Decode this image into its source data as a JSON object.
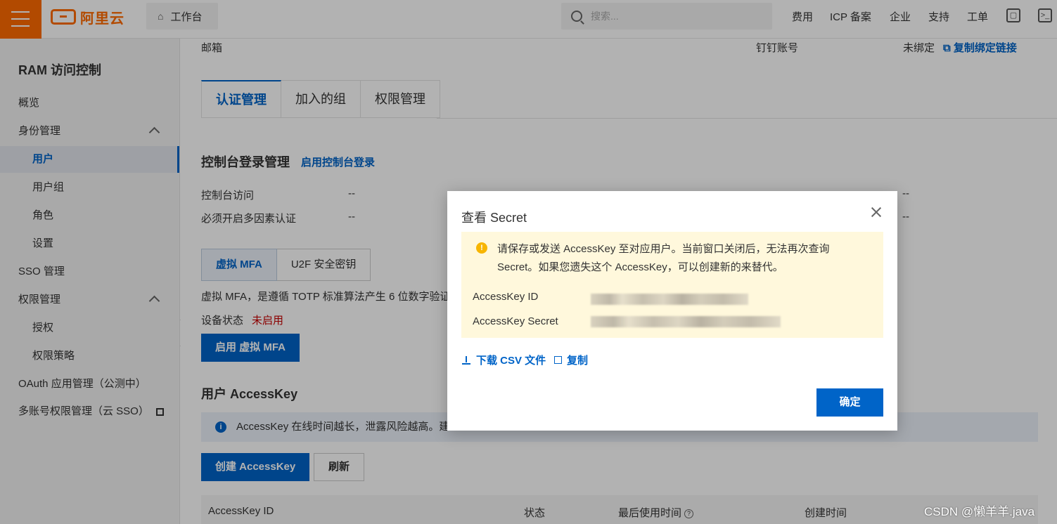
{
  "topbar": {
    "logo_text": "阿里云",
    "workbench": "工作台",
    "search_placeholder": "搜索...",
    "nav": [
      "费用",
      "ICP 备案",
      "企业",
      "支持",
      "工单"
    ]
  },
  "sidebar": {
    "title": "RAM 访问控制",
    "items": [
      {
        "label": "概览"
      },
      {
        "label": "身份管理"
      },
      {
        "label": "用户"
      },
      {
        "label": "用户组"
      },
      {
        "label": "角色"
      },
      {
        "label": "设置"
      },
      {
        "label": "SSO 管理"
      },
      {
        "label": "权限管理"
      },
      {
        "label": "授权"
      },
      {
        "label": "权限策略"
      },
      {
        "label": "OAuth 应用管理（公测中）"
      },
      {
        "label": "多账号权限管理（云 SSO）"
      }
    ]
  },
  "main": {
    "email_label": "邮箱",
    "dingtalk_label": "钉钉账号",
    "dingtalk_status": "未绑定",
    "copy_bind_link": "复制绑定链接",
    "tabs": [
      "认证管理",
      "加入的组",
      "权限管理"
    ],
    "console_section_title": "控制台登录管理",
    "enable_console_login": "启用控制台登录",
    "console_access_label": "控制台访问",
    "console_access_value": "--",
    "mfa_required_label": "必须开启多因素认证",
    "mfa_required_value": "--",
    "right_value_1": "--",
    "right_value_2": "--",
    "mfa_tabs": [
      "虚拟 MFA",
      "U2F 安全密钥"
    ],
    "mfa_desc": "虚拟 MFA，是遵循 TOTP 标准算法产生 6 位数字验证码",
    "device_status_label": "设备状态",
    "device_status_value": "未启用",
    "enable_mfa_button": "启用 虚拟 MFA",
    "accesskey_title": "用户 AccessKey",
    "accesskey_notice": "AccessKey 在线时间越长，泄露风险越高。建",
    "create_ak_button": "创建 AccessKey",
    "refresh_button": "刷新",
    "table_headers": [
      "AccessKey ID",
      "状态",
      "最后使用时间",
      "创建时间"
    ]
  },
  "modal": {
    "title": "查看 Secret",
    "warning": "请保存或发送 AccessKey 至对应用户。当前窗口关闭后，无法再次查询 Secret。如果您遗失这个 AccessKey，可以创建新的来替代。",
    "ak_id_label": "AccessKey ID",
    "ak_secret_label": "AccessKey Secret",
    "download_csv": "下载 CSV 文件",
    "copy": "复制",
    "ok_button": "确定"
  },
  "watermark": "CSDN @懒羊羊.java",
  "colors": {
    "brand_orange": "#ff6a00",
    "primary_blue": "#0064c8",
    "warning_bg": "#fff8dc"
  }
}
